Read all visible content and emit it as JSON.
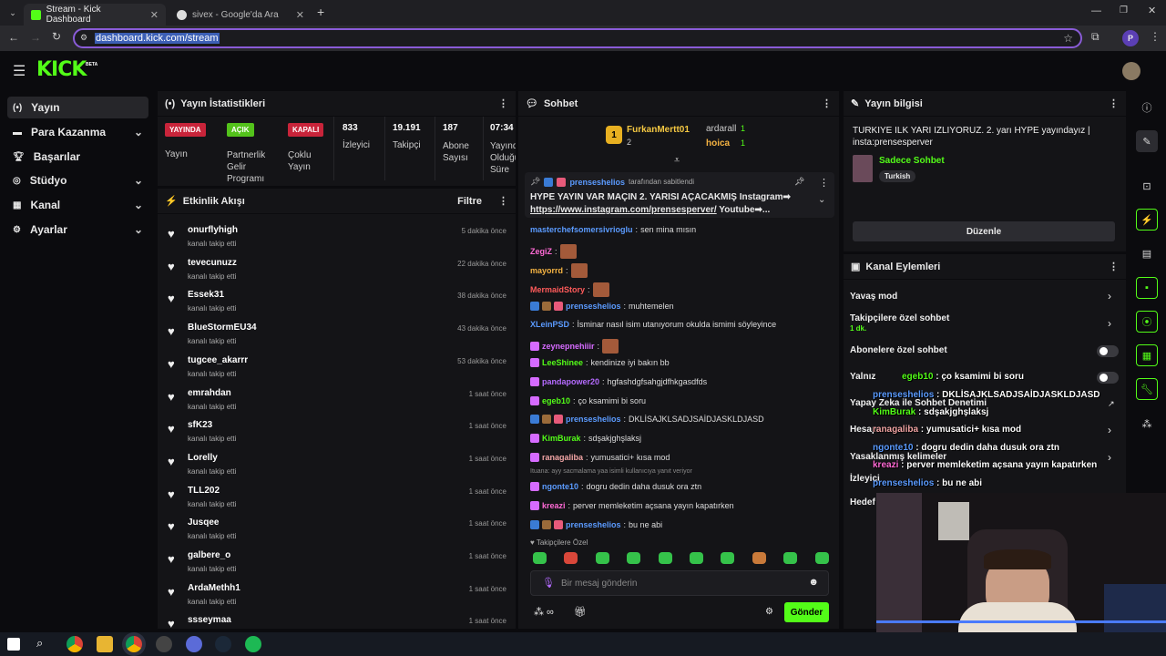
{
  "browser": {
    "tabs": [
      {
        "label": "Stream - Kick Dashboard"
      },
      {
        "label": "sivex - Google'da Ara"
      }
    ],
    "url": "dashboard.kick.com/stream",
    "profile": "P"
  },
  "header": {
    "logo": "KICK",
    "beta": "BETA"
  },
  "sidebar": {
    "items": [
      {
        "label": "Yayın",
        "icon": "broadcast-icon"
      },
      {
        "label": "Para Kazanma",
        "icon": "money-icon"
      },
      {
        "label": "Başarılar",
        "icon": "trophy-icon"
      },
      {
        "label": "Stüdyo",
        "icon": "studio-icon"
      },
      {
        "label": "Kanal",
        "icon": "channel-icon"
      },
      {
        "label": "Ayarlar",
        "icon": "gear-icon"
      }
    ]
  },
  "stats": {
    "title": "Yayın İstatistikleri",
    "live_badge": "YAYINDA",
    "live_label": "Yayın",
    "partner_badge": "AÇIK",
    "partner_label": "Partnerlik Gelir Programı",
    "multi_badge": "KAPALI",
    "multi_label": "Çoklu Yayın",
    "viewers_value": "833",
    "viewers_label": "İzleyici",
    "followers_value": "19.191",
    "followers_label": "Takipçi",
    "subs_value": "187",
    "subs_label": "Abone Sayısı",
    "duration_value": "07:34",
    "duration_label": "Yayında Olduğu Süre"
  },
  "activity": {
    "title": "Etkinlik Akışı",
    "filter": "Filtre",
    "events": [
      {
        "name": "onurflyhigh",
        "action": "kanalı takip etti",
        "time": "5 dakika önce"
      },
      {
        "name": "tevecunuzz",
        "action": "kanalı takip etti",
        "time": "22 dakika önce"
      },
      {
        "name": "Essek31",
        "action": "kanalı takip etti",
        "time": "38 dakika önce"
      },
      {
        "name": "BlueStormEU34",
        "action": "kanalı takip etti",
        "time": "43 dakika önce"
      },
      {
        "name": "tugcee_akarrr",
        "action": "kanalı takip etti",
        "time": "53 dakika önce"
      },
      {
        "name": "emrahdan",
        "action": "kanalı takip etti",
        "time": "1 saat önce"
      },
      {
        "name": "sfK23",
        "action": "kanalı takip etti",
        "time": "1 saat önce"
      },
      {
        "name": "Lorelly",
        "action": "kanalı takip etti",
        "time": "1 saat önce"
      },
      {
        "name": "TLL202",
        "action": "kanalı takip etti",
        "time": "1 saat önce"
      },
      {
        "name": "Jusqee",
        "action": "kanalı takip etti",
        "time": "1 saat önce"
      },
      {
        "name": "galbere_o",
        "action": "kanalı takip etti",
        "time": "1 saat önce"
      },
      {
        "name": "ArdaMethh1",
        "action": "kanalı takip etti",
        "time": "1 saat önce"
      },
      {
        "name": "ssseymaa",
        "action": "",
        "time": "1 saat önce"
      }
    ]
  },
  "chat": {
    "title": "Sohbet",
    "top": [
      {
        "name": "FurkanMertt01",
        "rank": "1",
        "count": "2"
      },
      {
        "name": "ardarall",
        "count": "1"
      },
      {
        "name": "hoica",
        "count": "1"
      }
    ],
    "pinned_by": "prenseshelios",
    "pinned_suffix": "tarafından sabitlendi",
    "pinned_text": "HYPE YAYIN VAR MAÇIN 2. YARISI AÇACAKMIŞ Instagram➡",
    "pinned_link": "https://www.instagram.com/prensesperver/",
    "pinned_tail": " Youtube➡...",
    "messages": [
      {
        "user": "masterchefsomersivrioglu",
        "text": "sen mina mısın",
        "color": "#5b9bff"
      },
      {
        "user": "ZegiZ",
        "text": "",
        "color": "#ff6ad5",
        "emote": true
      },
      {
        "user": "mayorrd",
        "text": "",
        "color": "#f5b342",
        "emote": true
      },
      {
        "user": "MermaidStory",
        "text": "",
        "color": "#ff5b5b",
        "emote": true
      },
      {
        "user": "prenseshelios",
        "text": "muhtemelen",
        "color": "#5b9bff",
        "badges": true
      },
      {
        "user": "XLeinPSD",
        "text": "İsminar nasıl isim utanıyorum okulda ismimi söyleyince",
        "color": "#5b9bff"
      },
      {
        "user": "zeynepnehiiir",
        "text": "",
        "color": "#d66bff",
        "emote": true
      },
      {
        "user": "LeeShinee",
        "text": "kendinize iyi bakın bb",
        "color": "#53fc18"
      },
      {
        "user": "pandapower20",
        "text": "hgfashdgfsahgjdfhkgasdfds",
        "color": "#b56bff"
      },
      {
        "user": "egeb10",
        "text": "ço ksamimi bi soru",
        "color": "#53fc18"
      },
      {
        "user": "prenseshelios",
        "text": "DKLİSAJKLSADJSAİDJASKLDJASD",
        "color": "#5b9bff",
        "badges": true
      },
      {
        "user": "KimBurak",
        "text": "sdşakjghşlaksj",
        "color": "#53fc18"
      },
      {
        "user": "ranagaliba",
        "text": "yumusatici+ kısa mod",
        "color": "#f2a5a5"
      },
      {
        "user": "ngonte10",
        "text": "dogru dedin daha dusuk ora ztn",
        "color": "#5b9bff",
        "reply": "Ituana: ayy sacmalama yaa isimli kullanıcıya yanıt veriyor"
      },
      {
        "user": "kreazi",
        "text": "perver memleketim açsana yayın kapatırken",
        "color": "#ff6ad5"
      },
      {
        "user": "prenseshelios",
        "text": "bu ne abi",
        "color": "#5b9bff",
        "badges": true
      }
    ],
    "followers_only": "Takipçilere Özel",
    "input_placeholder": "Bir mesaj gönderin",
    "send": "Gönder"
  },
  "streaminfo": {
    "title": "Yayın bilgisi",
    "text": "TURKIYE ILK YARI IZLIYORUZ. 2. yarı HYPE yayındayız | insta:prensesperver",
    "category": "Sadece Sohbet",
    "tag": "Turkish",
    "edit": "Düzenle"
  },
  "actions": {
    "title": "Kanal Eylemleri",
    "items": [
      "Yavaş mod",
      "Takipçilere özel sohbet",
      "Abonelere özel sohbet",
      "Yalnız",
      "Yapay Zeka ile Sohbet Denetimi",
      "Hesap",
      "Yasaklanmış kelimeler",
      "İzleyici",
      "Hedef"
    ],
    "followers_sub": "1 dk."
  },
  "overlay": [
    {
      "user": "egeb10",
      "text": "ço ksamimi bi soru",
      "color": "#53fc18"
    },
    {
      "user": "prenseshelios",
      "text": "DKLİSAJKLSADJSAİDJASKLDJASD",
      "color": "#5b9bff"
    },
    {
      "user": "KimBurak",
      "text": "sdşakjghşlaksj",
      "color": "#53fc18"
    },
    {
      "user": "ranagaliba",
      "text": "yumusatici+ kısa mod",
      "color": "#f2a5a5"
    },
    {
      "user": "ngonte10",
      "text": "dogru dedin daha dusuk ora ztn",
      "color": "#5b9bff"
    },
    {
      "user": "kreazi",
      "text": "perver memleketim açsana yayın kapatırken",
      "color": "#ff6ad5"
    },
    {
      "user": "prenseshelios",
      "text": "bu ne abi",
      "color": "#5b9bff"
    }
  ]
}
